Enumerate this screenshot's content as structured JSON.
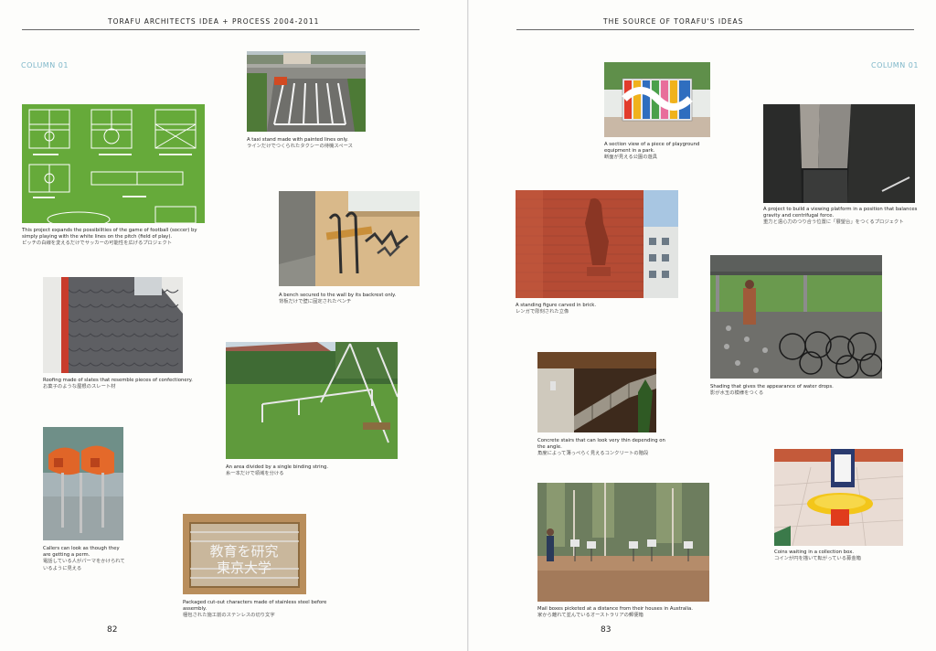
{
  "left_page": {
    "running_head": "TORAFU ARCHITECTS IDEA + PROCESS 2004-2011",
    "column_label": "COLUMN 01",
    "page_number": "82",
    "captions": {
      "taxi": {
        "en": "A taxi stand made with painted lines only.",
        "ja": "ラインだけでつくられたタクシーの待機スペース"
      },
      "football": {
        "en": "This project expands the possibilities of the game of football (soccer) by simply playing with the white lines on the pitch (field of play).",
        "ja": "ピッチの白線を変えるだけでサッカーの可能性を広げるプロジェクト"
      },
      "bench": {
        "en": "A bench secured to the wall by its backrest only.",
        "ja": "背板だけで壁に固定されたベンチ"
      },
      "roof": {
        "en": "Roofing made of slates that resemble pieces of confectionery.",
        "ja": "お菓子のような屋根のスレート材"
      },
      "string": {
        "en": "An area divided by a single binding string.",
        "ja": "糸一本だけで領域を分ける"
      },
      "phone": {
        "en": "Callers can look as though they are getting a perm.",
        "ja": "電話している人がパーマをかけられているように見える"
      },
      "chars": {
        "en": "Packaged cut-out characters made of stainless steel before assembly.",
        "ja": "梱包された施工前のステンレスの切り文字"
      }
    }
  },
  "right_page": {
    "running_head": "THE SOURCE OF TORAFU'S IDEAS",
    "column_label": "COLUMN 01",
    "page_number": "83",
    "captions": {
      "playground": {
        "en": "A section view of a piece of playground equipment in a park.",
        "ja": "断面が見える公園の遊具"
      },
      "viewing": {
        "en": "A project to build a viewing platform in a position that balances gravity and centrifugal force.",
        "ja": "重力と遠心力のつり合う位置に「展望台」をつくるプロジェクト"
      },
      "brick": {
        "en": "A standing figure carved in brick.",
        "ja": "レンガで彫刻された立像"
      },
      "shading": {
        "en": "Shading that gives the appearance of water drops.",
        "ja": "影が水玉の模様をつくる"
      },
      "stairs": {
        "en": "Concrete stairs that can look very thin depending on the angle.",
        "ja": "角度によって薄っぺらく見えるコンクリートの階段"
      },
      "coins": {
        "en": "Coins waiting in a collection box.",
        "ja": "コインが円を描いて転がっている募金箱"
      },
      "mailbox": {
        "en": "Mail boxes picketed at a distance from their houses in Australia.",
        "ja": "家から離れて並んでいるオーストラリアの郵便箱"
      }
    }
  },
  "photo_art": {
    "pitch_color": "#66aa3a",
    "sign_lines": [
      "教育を研究",
      "東京大学"
    ],
    "accent_blue": "#7eb7c9"
  }
}
